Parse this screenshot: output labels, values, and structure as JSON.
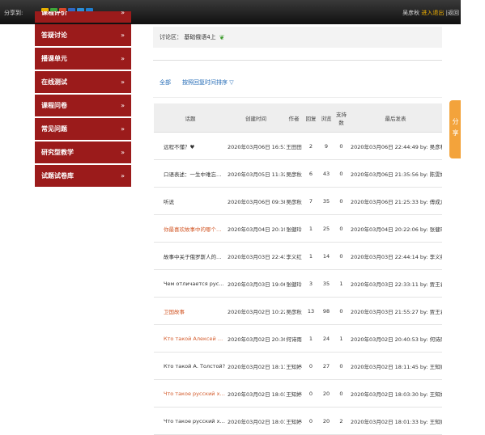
{
  "topbar": {
    "share_label": "分享到:",
    "share_icons": [
      {
        "name": "qzone-icon",
        "color": "#e8b200"
      },
      {
        "name": "sina-weibo-icon",
        "color": "#3fa83a"
      },
      {
        "name": "tencent-weibo-icon",
        "color": "#d8472b"
      },
      {
        "name": "renren-icon",
        "color": "#2f69c6"
      },
      {
        "name": "kaixin-icon",
        "color": "#2a8fd8"
      },
      {
        "name": "more-share-icon",
        "color": "#1e7fd0"
      }
    ],
    "user_name": "吴彦秋",
    "user_links": "进入退出",
    "user_tail": "|返回"
  },
  "sidebar": {
    "items": [
      {
        "label": "课程评价"
      },
      {
        "label": "答疑讨论"
      },
      {
        "label": "播课单元"
      },
      {
        "label": "在线测试"
      },
      {
        "label": "课程问卷"
      },
      {
        "label": "常见问题"
      },
      {
        "label": "研究型教学"
      },
      {
        "label": "试题试卷库"
      }
    ],
    "chevron": "»"
  },
  "breadcrumb": {
    "text": "讨论区： 基础俄语4上",
    "leaf_icon": "leaf-icon"
  },
  "filters": {
    "all": "全部",
    "sort": "按照回复时间排序 ▽"
  },
  "table": {
    "headers": [
      "话题",
      "创建时间",
      "作者",
      "回复",
      "浏览",
      "支持数",
      "最后发表"
    ],
    "rows": [
      {
        "title": "远程不懂？♥",
        "created": "2020年03月06日 16:51:31",
        "author": "王田田",
        "replies": "2",
        "views": "9",
        "likes": "0",
        "last": "2020年03月06日 22:44:49 by: 吴彦秋",
        "red": false
      },
      {
        "title": "口语表述：一生中难忘的事！",
        "created": "2020年03月05日 11:32:40",
        "author": "吴彦秋",
        "replies": "6",
        "views": "43",
        "likes": "0",
        "last": "2020年03月06日 21:35:56 by: 陈雯婷",
        "red": false
      },
      {
        "title": "听说",
        "created": "2020年03月06日 09:38:03",
        "author": "吴彦秋",
        "replies": "7",
        "views": "35",
        "likes": "0",
        "last": "2020年03月06日 21:25:33 by: 傅成龙",
        "red": false
      },
      {
        "title": "你最喜欢故事中的哪个人物？为…",
        "created": "2020年03月04日 20:19:43",
        "author": "张健玲",
        "replies": "1",
        "views": "25",
        "likes": "0",
        "last": "2020年03月04日 20:22:06 by: 张健玲",
        "red": true
      },
      {
        "title": "故事中关于俄罗斯人的性格？",
        "created": "2020年03月03日 22:43:35",
        "author": "李义红",
        "replies": "1",
        "views": "14",
        "likes": "0",
        "last": "2020年03月03日 22:44:14 by: 李义红",
        "red": false
      },
      {
        "title": "Чем отличается русский хар…",
        "created": "2020年03月03日 19:06:41",
        "author": "张健玲",
        "replies": "3",
        "views": "35",
        "likes": "1",
        "last": "2020年03月03日 22:33:11 by: 贾王君",
        "red": false
      },
      {
        "title": "卫国故事",
        "created": "2020年03月02日 10:22:19",
        "author": "吴彦秋",
        "replies": "13",
        "views": "98",
        "likes": "0",
        "last": "2020年03月03日 21:55:27 by: 贾王君",
        "red": true
      },
      {
        "title": "Кто такой Алексей Николае…",
        "created": "2020年03月02日 20:30:40",
        "author": "何诗雨",
        "replies": "1",
        "views": "24",
        "likes": "1",
        "last": "2020年03月02日 20:40:53 by: 何诗雨",
        "red": true
      },
      {
        "title": "Кто такой А. Толстой?",
        "created": "2020年03月02日 18:11:45",
        "author": "王知婷",
        "replies": "0",
        "views": "27",
        "likes": "0",
        "last": "2020年03月02日 18:11:45 by: 王知婷",
        "red": false
      },
      {
        "title": "Что такое русский характер?",
        "created": "2020年03月02日 18:03:30",
        "author": "王知婷",
        "replies": "0",
        "views": "20",
        "likes": "0",
        "last": "2020年03月02日 18:03:30 by: 王知婷",
        "red": true
      },
      {
        "title": "Что такое русский характер?",
        "created": "2020年03月02日 18:01:33",
        "author": "王知婷",
        "replies": "0",
        "views": "20",
        "likes": "2",
        "last": "2020年03月02日 18:01:33 by: 王知婷",
        "red": false
      }
    ]
  },
  "share_tab": {
    "label": "分享"
  }
}
